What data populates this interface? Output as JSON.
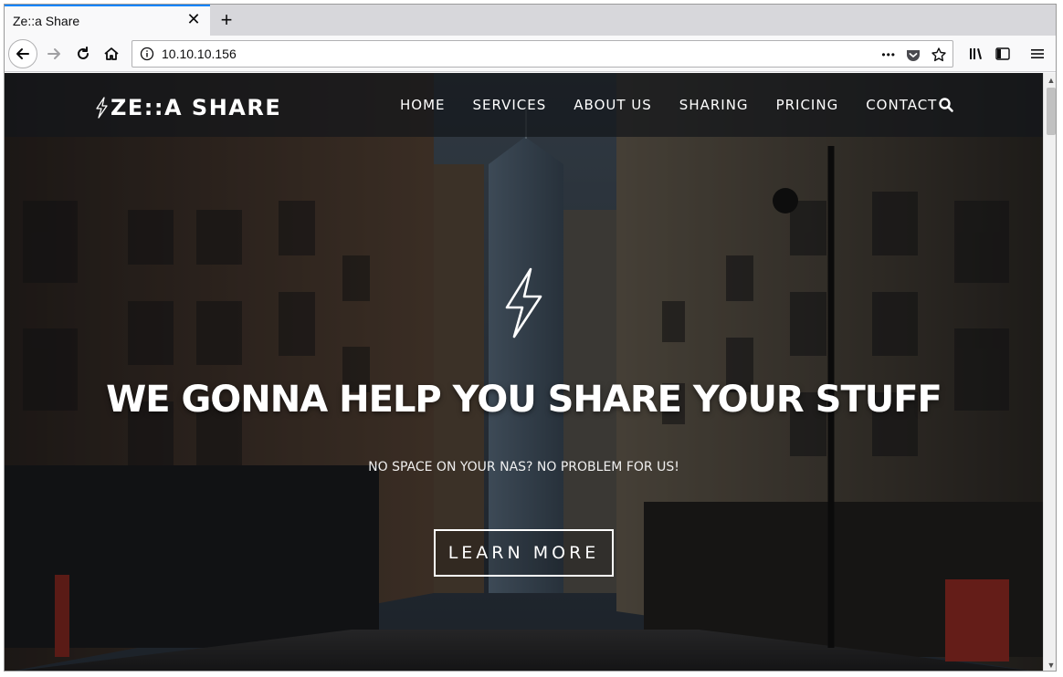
{
  "browser": {
    "tab_title": "Ze::a Share",
    "tab_close": "✕",
    "new_tab": "+",
    "url": "10.10.10.156",
    "page_actions": "•••",
    "icons": [
      "back-icon",
      "forward-icon",
      "reload-icon",
      "home-icon",
      "info-icon",
      "pocket-icon",
      "star-icon",
      "library-icon",
      "sidebar-icon",
      "menu-icon"
    ]
  },
  "site": {
    "brand": "ZE::A SHARE",
    "nav": [
      {
        "label": "HOME"
      },
      {
        "label": "SERVICES"
      },
      {
        "label": "ABOUT US"
      },
      {
        "label": "SHARING"
      },
      {
        "label": "PRICING"
      },
      {
        "label": "CONTACT"
      }
    ]
  },
  "hero": {
    "title": "WE GONNA HELP YOU SHARE YOUR STUFF",
    "subtitle": "NO SPACE ON YOUR NAS? NO PROBLEM FOR US!",
    "cta": "LEARN MORE"
  },
  "colors": {
    "accent_tab": "#0a84ff",
    "header_bg": "#14161a",
    "text": "#ffffff"
  }
}
